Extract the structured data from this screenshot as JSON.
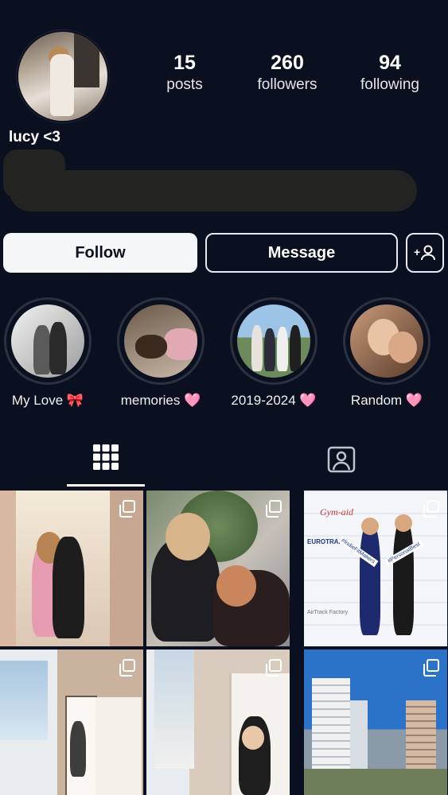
{
  "profile": {
    "username": "lucy <3",
    "stats": [
      {
        "value": "15",
        "label": "posts"
      },
      {
        "value": "260",
        "label": "followers"
      },
      {
        "value": "94",
        "label": "following"
      }
    ]
  },
  "actions": {
    "follow_label": "Follow",
    "message_label": "Message"
  },
  "highlights": [
    {
      "label": "My Love 🎀"
    },
    {
      "label": "memories 🩷"
    },
    {
      "label": "2019-2024 🩷"
    },
    {
      "label": "Random 🩷"
    }
  ],
  "tabs": [
    {
      "icon": "grid-icon",
      "active": true
    },
    {
      "icon": "tagged-icon",
      "active": false
    }
  ],
  "posts": {
    "tile3_words": [
      "Gym-aid",
      "EUROTRAMP",
      "AirTrack Factory"
    ],
    "tile3_sash_left": "#IndieFitMakers",
    "tile3_sash_right": "#PersonalBest"
  },
  "colors": {
    "background": "#0b1020",
    "button_primary": "#f5f6f8",
    "border": "#e8e8ee"
  }
}
